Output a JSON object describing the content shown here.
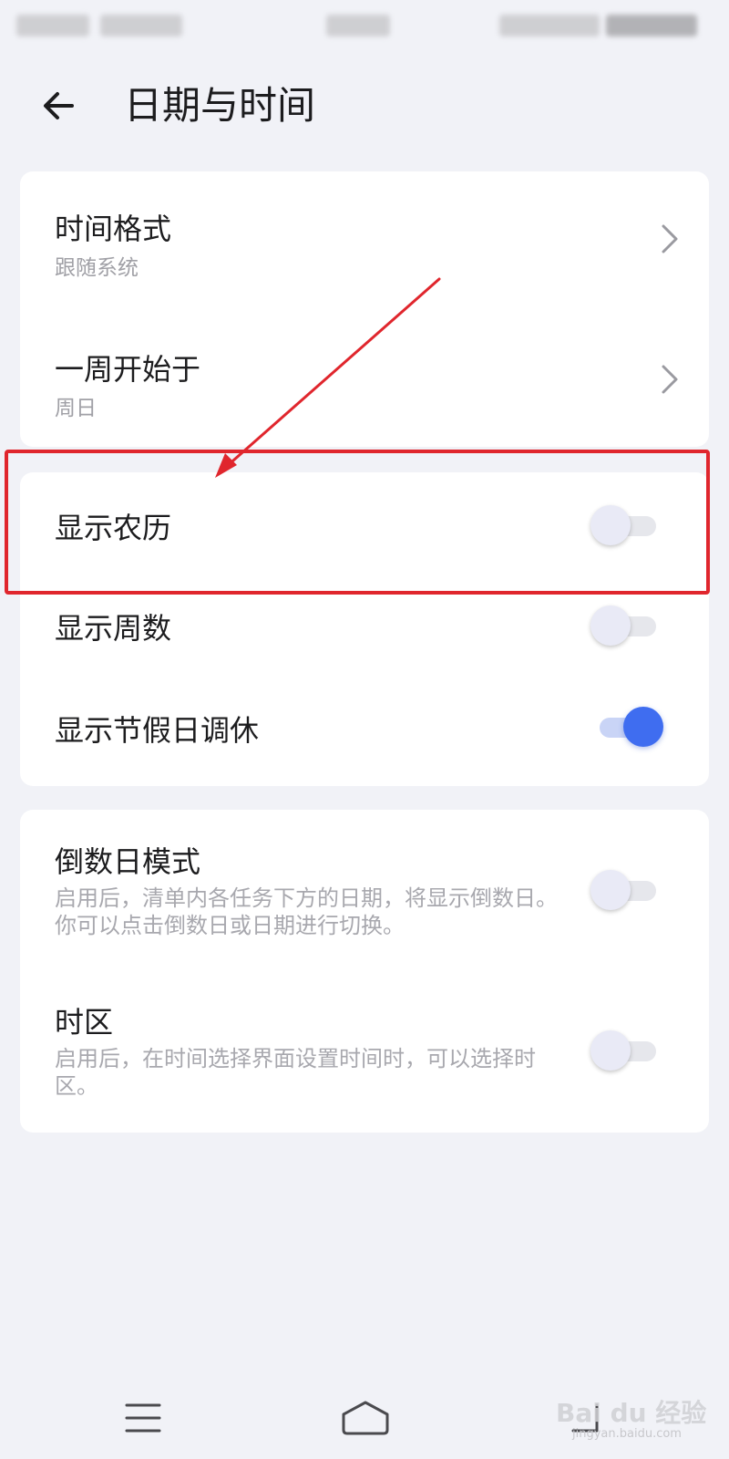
{
  "header": {
    "title": "日期与时间"
  },
  "card1": {
    "rows": [
      {
        "title": "时间格式",
        "subtitle": "跟随系统"
      },
      {
        "title": "一周开始于",
        "subtitle": "周日"
      }
    ]
  },
  "card2": {
    "rows": [
      {
        "title": "显示农历",
        "enabled": false
      },
      {
        "title": "显示周数",
        "enabled": false
      },
      {
        "title": "显示节假日调休",
        "enabled": true
      }
    ]
  },
  "card3": {
    "rows": [
      {
        "title": "倒数日模式",
        "description": "启用后，清单内各任务下方的日期，将显示倒数日。你可以点击倒数日或日期进行切换。",
        "enabled": false
      },
      {
        "title": "时区",
        "description": "启用后，在时间选择界面设置时间时，可以选择时区。",
        "enabled": false
      }
    ]
  },
  "watermark": {
    "text": "Bai du 经验",
    "sub": "jingyan.baidu.com"
  },
  "colors": {
    "accent": "#3f6df0",
    "annotation": "#e0262d",
    "background": "#f1f2f7"
  },
  "icons": {
    "back": "arrow-left-icon",
    "chevron": "chevron-right-icon",
    "nav_menu": "menu-icon",
    "nav_home": "home-icon",
    "nav_back": "back-nav-icon"
  }
}
